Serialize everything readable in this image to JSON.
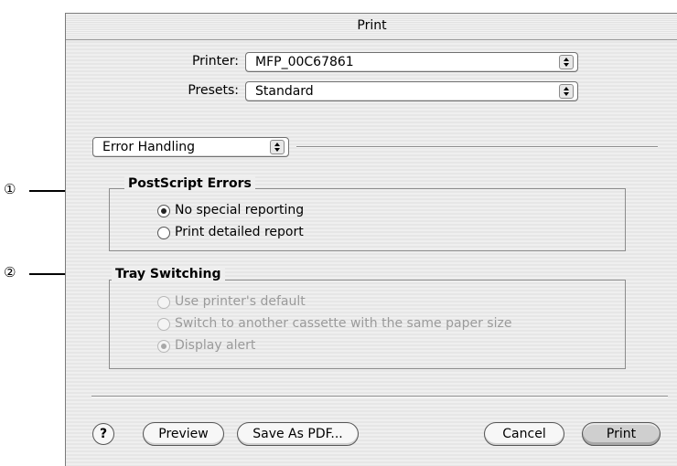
{
  "window": {
    "title": "Print"
  },
  "printer": {
    "label": "Printer:",
    "value": "MFP_00C67861"
  },
  "presets": {
    "label": "Presets:",
    "value": "Standard"
  },
  "panel": {
    "value": "Error Handling"
  },
  "postscript": {
    "title": "PostScript Errors",
    "options": [
      {
        "label": "No special reporting",
        "selected": true
      },
      {
        "label": "Print detailed report",
        "selected": false
      }
    ]
  },
  "tray": {
    "title": "Tray Switching",
    "enabled": false,
    "options": [
      {
        "label": "Use printer's default",
        "selected": false
      },
      {
        "label": "Switch to another cassette with the same paper size",
        "selected": false
      },
      {
        "label": "Display alert",
        "selected": true
      }
    ]
  },
  "buttons": {
    "help": "?",
    "preview": "Preview",
    "save_pdf": "Save As PDF...",
    "cancel": "Cancel",
    "print": "Print"
  },
  "callouts": [
    "①",
    "②"
  ]
}
